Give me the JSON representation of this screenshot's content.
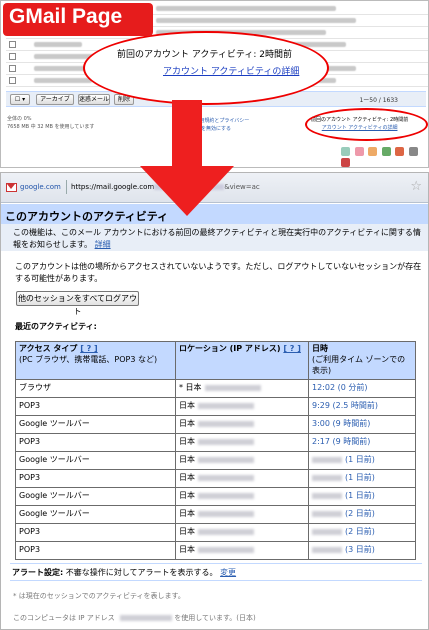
{
  "banner": {
    "label": "GMail Page"
  },
  "callout": {
    "line1": "前回のアカウント アクティビティ: 2時間前",
    "line2": "アカウント アクティビティの詳細"
  },
  "gmail_toolbar": {
    "archive": "アーカイブ",
    "spam": "迷惑メール",
    "delete": "削除",
    "pager": "1ー50 / 1633"
  },
  "gmail_footer": {
    "storage_line1": "全体の 0%",
    "storage_line2": "7658 MB 中 32 MB を使用しています",
    "terms_line1": "- 利用規約とプライバシー",
    "terms_line2": "ジスを無効にする",
    "small_line1": "前回のアカウント アクティビティ: 2時間前",
    "small_line2": "アカウント アクティビティの詳細"
  },
  "browser": {
    "tab_title": "google.com",
    "url_prefix": "https://mail.google.com",
    "url_suffix": "&view=ac"
  },
  "activity": {
    "title": "このアカウントのアクティビティ",
    "description": "この機能は、このメール アカウントにおける前回の最終アクティビティと現在実行中のアクティビティに関する情報をお知らせします。",
    "details_link": "詳細",
    "notice": "このアカウントは他の場所からアクセスされていないようです。ただし、ログアウトしていないセッションが存在する可能性があります。",
    "logout_button": "他のセッションをすべてログアウト",
    "recent_label": "最近のアクティビティ:",
    "headers": {
      "access_type": "アクセス タイプ",
      "access_type_help": "[ ? ]",
      "access_type_sub": "(PC ブラウザ、携帯電話、POP3 など)",
      "location": "ロケーション (IP アドレス)",
      "location_help": "[ ? ]",
      "datetime": "日時",
      "datetime_sub": "(ご利用タイム ゾーンでの表示)"
    },
    "rows": [
      {
        "type": "ブラウザ",
        "location": "* 日本",
        "time": "12:02 (0 分前)"
      },
      {
        "type": "POP3",
        "location": "日本",
        "time": "9:29 (2.5 時間前)"
      },
      {
        "type": "Google ツールバー",
        "location": "日本",
        "time": "3:00 (9 時間前)"
      },
      {
        "type": "POP3",
        "location": "日本",
        "time": "2:17 (9 時間前)"
      },
      {
        "type": "Google ツールバー",
        "location": "日本",
        "time": "(1 日前)"
      },
      {
        "type": "POP3",
        "location": "日本",
        "time": "(1 日前)"
      },
      {
        "type": "Google ツールバー",
        "location": "日本",
        "time": "(1 日前)"
      },
      {
        "type": "Google ツールバー",
        "location": "日本",
        "time": "(2 日前)"
      },
      {
        "type": "POP3",
        "location": "日本",
        "time": "(2 日前)"
      },
      {
        "type": "POP3",
        "location": "日本",
        "time": "(3 日前)"
      }
    ],
    "alert_label": "アラート設定:",
    "alert_text": "不審な操作に対してアラートを表示する。",
    "alert_link": "変更",
    "footnote": "* は現在のセッションでのアクティビティを表します。",
    "ip_prefix": "このコンピュータは IP アドレス",
    "ip_suffix": "を使用しています。(日本)"
  },
  "colors": {
    "accent_red": "#ee1f1f",
    "header_blue": "#c3d9ff",
    "light_blue": "#e8eef7",
    "link_blue": "#2a5db0"
  }
}
